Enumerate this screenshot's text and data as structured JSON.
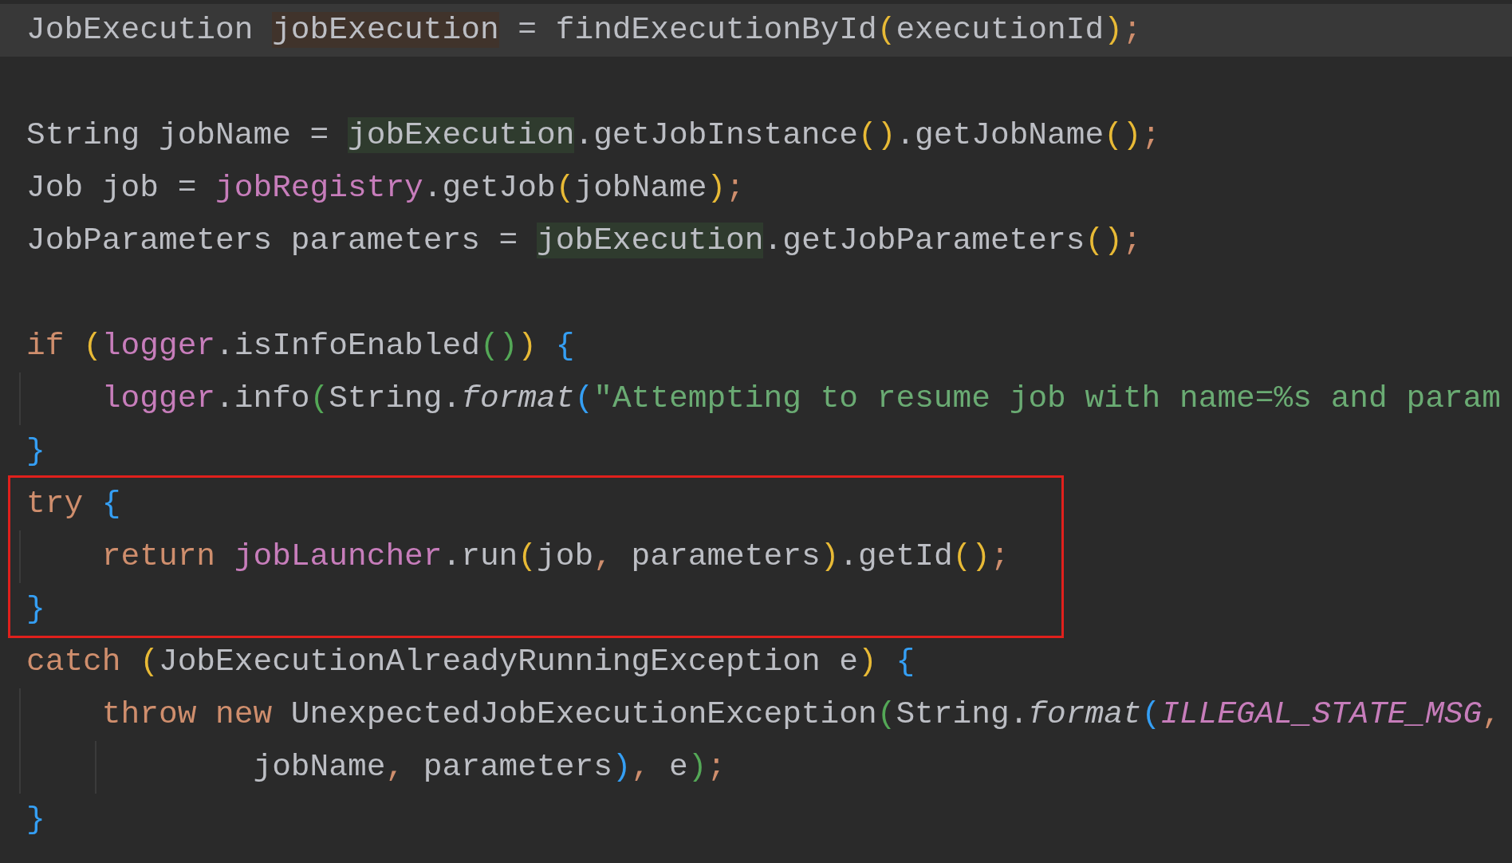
{
  "editor": {
    "lines": [
      {
        "current": true,
        "boxed": false,
        "tokens": [
          {
            "kind": "text",
            "text": "JobExecution "
          },
          {
            "kind": "text",
            "text": "jobExecution",
            "color": "#40332b"
          },
          {
            "kind": "text",
            "text": " = findExecutionById"
          },
          {
            "kind": "paren",
            "color": "#e8ba36",
            "text": "("
          },
          {
            "kind": "text",
            "text": "executionId"
          },
          {
            "kind": "paren",
            "color": "#e8ba36",
            "text": ")"
          },
          {
            "kind": "punct",
            "text": ";"
          }
        ]
      },
      {
        "current": false,
        "boxed": false
      },
      {
        "current": false,
        "boxed": false,
        "tokens": [
          {
            "kind": "text",
            "text": "String jobName = "
          },
          {
            "kind": "text",
            "text": "jobExecution",
            "color": "#2f3b2e"
          },
          {
            "kind": "text",
            "text": ".getJobInstance"
          },
          {
            "kind": "paren",
            "color": "#e8ba36",
            "text": "()"
          },
          {
            "kind": "text",
            "text": ".getJobName"
          },
          {
            "kind": "paren",
            "color": "#e8ba36",
            "text": "()"
          },
          {
            "kind": "punct",
            "text": ";"
          }
        ]
      },
      {
        "current": false,
        "boxed": false,
        "tokens": [
          {
            "kind": "text",
            "text": "Job job = "
          },
          {
            "kind": "field",
            "text": "jobRegistry"
          },
          {
            "kind": "text",
            "text": ".getJob"
          },
          {
            "kind": "paren",
            "color": "#e8ba36",
            "text": "("
          },
          {
            "kind": "text",
            "text": "jobName"
          },
          {
            "kind": "paren",
            "color": "#e8ba36",
            "text": ")"
          },
          {
            "kind": "punct",
            "text": ";"
          }
        ]
      },
      {
        "current": false,
        "boxed": false,
        "tokens": [
          {
            "kind": "text",
            "text": "JobParameters parameters = "
          },
          {
            "kind": "text",
            "text": "jobExecution",
            "color": "#2f3b2e"
          },
          {
            "kind": "text",
            "text": ".getJobParameters"
          },
          {
            "kind": "paren",
            "color": "#e8ba36",
            "text": "()"
          },
          {
            "kind": "punct",
            "text": ";"
          }
        ]
      },
      {
        "current": false,
        "boxed": false
      },
      {
        "current": false,
        "boxed": false,
        "tokens": [
          {
            "kind": "keyword",
            "text": "if "
          },
          {
            "kind": "paren",
            "color": "#e8ba36",
            "text": "("
          },
          {
            "kind": "field",
            "text": "logger"
          },
          {
            "kind": "text",
            "text": ".isInfoEnabled"
          },
          {
            "kind": "paren",
            "color": "#54a857",
            "text": "()"
          },
          {
            "kind": "paren",
            "color": "#e8ba36",
            "text": ") "
          },
          {
            "kind": "paren",
            "color": "#359ff4",
            "text": "{"
          }
        ]
      },
      {
        "current": false,
        "boxed": false,
        "tokens": [
          {
            "kind": "field",
            "text": "    logger"
          },
          {
            "kind": "text",
            "text": ".info"
          },
          {
            "kind": "paren",
            "color": "#54a857",
            "text": "("
          },
          {
            "kind": "text",
            "text": "String."
          },
          {
            "kind": "static",
            "text": "format"
          },
          {
            "kind": "paren",
            "color": "#359ff4",
            "text": "("
          },
          {
            "kind": "string",
            "text": "\"Attempting to resume job with name=%s and param"
          }
        ]
      },
      {
        "current": false,
        "boxed": false,
        "tokens": [
          {
            "kind": "paren",
            "color": "#359ff4",
            "text": "}"
          }
        ]
      },
      {
        "current": false,
        "boxed": true,
        "tokens": [
          {
            "kind": "keyword",
            "text": "try "
          },
          {
            "kind": "paren",
            "color": "#359ff4",
            "text": "{"
          }
        ]
      },
      {
        "current": false,
        "boxed": true,
        "tokens": [
          {
            "kind": "keyword",
            "text": "    return "
          },
          {
            "kind": "field",
            "text": "jobLauncher"
          },
          {
            "kind": "text",
            "text": ".run"
          },
          {
            "kind": "paren",
            "color": "#e8ba36",
            "text": "("
          },
          {
            "kind": "text",
            "text": "job"
          },
          {
            "kind": "punct",
            "text": ", "
          },
          {
            "kind": "text",
            "text": "parameters"
          },
          {
            "kind": "paren",
            "color": "#e8ba36",
            "text": ")"
          },
          {
            "kind": "text",
            "text": ".getId"
          },
          {
            "kind": "paren",
            "color": "#e8ba36",
            "text": "()"
          },
          {
            "kind": "punct",
            "text": ";"
          }
        ]
      },
      {
        "current": false,
        "boxed": true,
        "tokens": [
          {
            "kind": "paren",
            "color": "#359ff4",
            "text": "}"
          }
        ]
      },
      {
        "current": false,
        "boxed": false,
        "tokens": [
          {
            "kind": "keyword",
            "text": "catch "
          },
          {
            "kind": "paren",
            "color": "#e8ba36",
            "text": "("
          },
          {
            "kind": "text",
            "text": "JobExecutionAlreadyRunningException e"
          },
          {
            "kind": "paren",
            "color": "#e8ba36",
            "text": ") "
          },
          {
            "kind": "paren",
            "color": "#359ff4",
            "text": "{"
          }
        ]
      },
      {
        "current": false,
        "boxed": false,
        "tokens": [
          {
            "kind": "keyword",
            "text": "    throw new "
          },
          {
            "kind": "text",
            "text": "UnexpectedJobExecutionException"
          },
          {
            "kind": "paren",
            "color": "#54a857",
            "text": "("
          },
          {
            "kind": "text",
            "text": "String."
          },
          {
            "kind": "static",
            "text": "format"
          },
          {
            "kind": "paren",
            "color": "#359ff4",
            "text": "("
          },
          {
            "kind": "constant",
            "text": "ILLEGAL_STATE_MSG"
          },
          {
            "kind": "punct",
            "text": ","
          }
        ]
      },
      {
        "current": false,
        "boxed": false,
        "tokens": [
          {
            "kind": "text",
            "text": "            jobName"
          },
          {
            "kind": "punct",
            "text": ", "
          },
          {
            "kind": "text",
            "text": "parameters"
          },
          {
            "kind": "paren",
            "color": "#359ff4",
            "text": ")"
          },
          {
            "kind": "punct",
            "text": ", "
          },
          {
            "kind": "text",
            "text": "e"
          },
          {
            "kind": "paren",
            "color": "#54a857",
            "text": ")"
          },
          {
            "kind": "punct",
            "text": ";"
          }
        ]
      },
      {
        "current": false,
        "boxed": false,
        "tokens": [
          {
            "kind": "paren",
            "color": "#359ff4",
            "text": "}"
          }
        ]
      }
    ]
  }
}
